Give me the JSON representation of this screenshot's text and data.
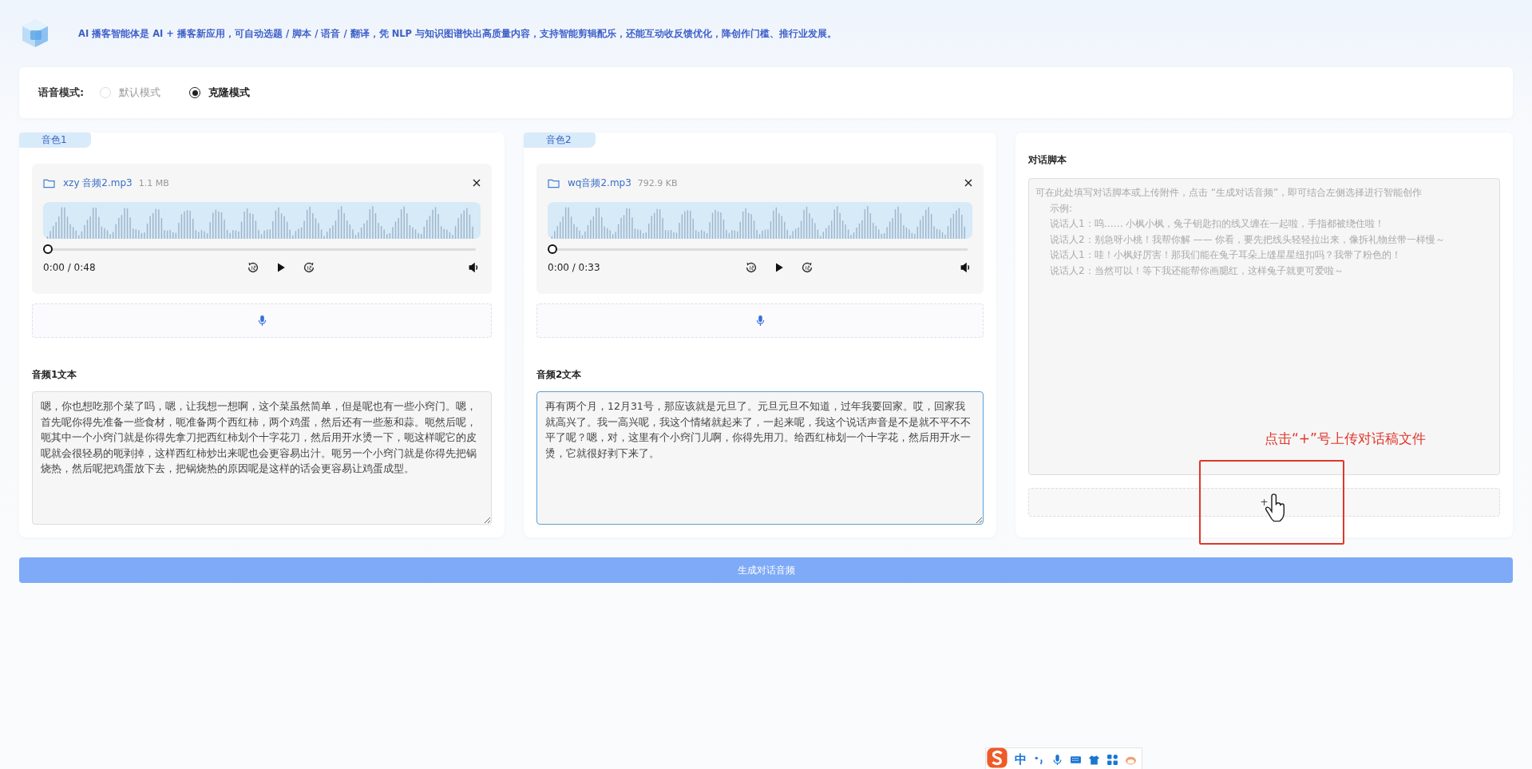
{
  "header": {
    "text": "AI 播客智能体是 AI + 播客新应用，可自动选题 / 脚本 / 语音 / 翻译，凭 NLP 与知识图谱快出高质量内容，支持智能剪辑配乐，还能互动收反馈优化，降创作门槛、推行业发展。"
  },
  "voice_mode": {
    "label": "语音模式:",
    "options": [
      {
        "label": "默认模式",
        "selected": false
      },
      {
        "label": "克隆模式",
        "selected": true
      }
    ]
  },
  "voices": [
    {
      "tab": "音色1",
      "file": {
        "name": "xzy 音频2.mp3",
        "size": "1.1 MB"
      },
      "player": {
        "time": "0:00 / 0:48",
        "level": 0
      },
      "text_label": "音频1文本",
      "text": "嗯，你也想吃那个菜了吗，嗯，让我想一想啊，这个菜虽然简单，但是呢也有一些小窍门。嗯，首先呢你得先准备一些食材，呃准备两个西红柿，两个鸡蛋，然后还有一些葱和蒜。呃然后呢，呃其中一个小窍门就是你得先拿刀把西红柿划个十字花刀，然后用开水烫一下，呃这样呢它的皮呢就会很轻易的呃剥掉，这样西红柿炒出来呢也会更容易出汁。呃另一个小窍门就是你得先把锅烧热，然后呢把鸡蛋放下去，把锅烧热的原因呢是这样的话会更容易让鸡蛋成型。",
      "focused": false
    },
    {
      "tab": "音色2",
      "file": {
        "name": "wq音频2.mp3",
        "size": "792.9 KB"
      },
      "player": {
        "time": "0:00 / 0:33",
        "level": 0
      },
      "text_label": "音频2文本",
      "text": "再有两个月，12月31号，那应该就是元旦了。元旦元旦不知道，过年我要回家。哎，回家我就高兴了。我一高兴呢，我这个情绪就起来了，一起来呢，我这个说话声音是不是就不平不不平了呢？嗯，对，这里有个小窍门儿啊，你得先用刀。给西红柿划一个十字花，然后用开水一烫，它就很好剥下来了。",
      "focused": true
    }
  ],
  "script": {
    "label": "对话脚本",
    "placeholder_lines": [
      "可在此处填写对话脚本或上传附件，点击 “生成对话音频”，即可结合左侧选择进行智能创作",
      "示例:",
      "说话人1：呜…… 小枫小枫，兔子钥匙扣的线又缠在一起啦，手指都被绕住啦！",
      "说话人2：别急呀小桃！我帮你解 —— 你看，要先把线头轻轻拉出来，像拆礼物丝带一样慢～",
      "说话人1：哇！小枫好厉害！那我们能在兔子耳朵上缝星星纽扣吗？我带了粉色的！",
      "说话人2：当然可以！等下我还能帮你画腮红，这样兔子就更可爱啦～"
    ],
    "upload": "+"
  },
  "annotation": {
    "text": "点击“+”号上传对话稿文件"
  },
  "generate_button": "生成对话音频",
  "ime_toolbar": {
    "mode": "中"
  }
}
